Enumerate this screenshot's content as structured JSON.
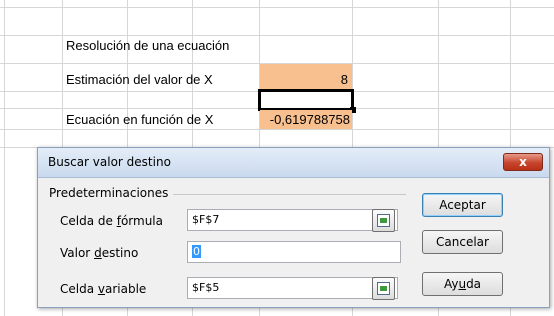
{
  "sheet": {
    "cells": {
      "a3": "Resolución de una ecuación",
      "a5_label": "Estimación del valor de X",
      "f5_value": "8",
      "a7_label": "Ecuación en función de X",
      "f7_value": "-0,619788758"
    },
    "fill_color": "#f9c08f"
  },
  "dialog": {
    "title": "Buscar valor destino",
    "close_label": "x",
    "group_label": "Predeterminaciones",
    "formula_cell": {
      "label_pre": "Celda de ",
      "label_u": "f",
      "label_post": "órmula",
      "value": "$F$7"
    },
    "target_value": {
      "label_pre": "Valor ",
      "label_u": "d",
      "label_post": "estino",
      "value": "0"
    },
    "variable_cell": {
      "label_pre": "Celda ",
      "label_u": "v",
      "label_post": "ariable",
      "value": "$F$5"
    },
    "buttons": {
      "ok": "Aceptar",
      "cancel": "Cancelar",
      "help_pre": "Ay",
      "help_u": "u",
      "help_post": "da"
    },
    "icons": {
      "shrink": "shrink-dialog-icon",
      "close": "close-icon"
    }
  }
}
